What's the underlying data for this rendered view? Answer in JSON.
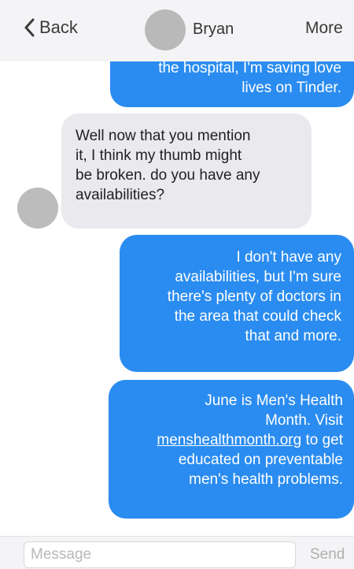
{
  "header": {
    "back_label": "Back",
    "contact_name": "Bryan",
    "more_label": "More"
  },
  "messages": [
    {
      "direction": "outgoing",
      "lines": [
        "the hospital, I'm saving love",
        "lives on Tinder."
      ]
    },
    {
      "direction": "incoming",
      "lines": [
        "Well now that you mention",
        "it, I think my thumb might",
        "be broken. do you have any",
        "availabilities?"
      ]
    },
    {
      "direction": "outgoing",
      "lines": [
        "I don't have any",
        "availabilities, but I'm sure",
        "there's plenty of doctors in",
        "the area that could check",
        "that and more."
      ]
    },
    {
      "direction": "outgoing",
      "lines": [
        "June is Men's Health",
        "Month. Visit"
      ],
      "link_text": "menshealthmonth.org",
      "link_suffix": " to get",
      "after_lines": [
        "educated on preventable",
        "men's health problems."
      ]
    }
  ],
  "composer": {
    "placeholder": "Message",
    "value": "",
    "send_label": "Send"
  },
  "colors": {
    "outgoing_bubble": "#2a8cf0",
    "incoming_bubble": "#e9e9ee",
    "header_bg": "#f4f4f6"
  },
  "icons": {
    "back": "chevron-left-icon"
  }
}
